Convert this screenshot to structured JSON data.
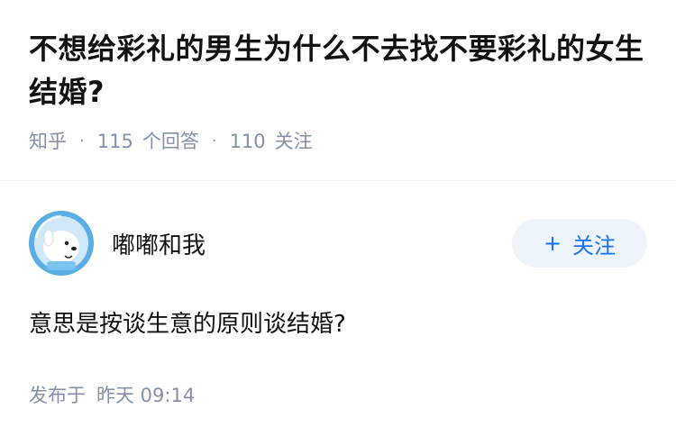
{
  "question": {
    "title": "不想给彩礼的男生为什么不去找不要彩礼的女生结婚?",
    "source": "知乎",
    "answer_count": "115",
    "answer_label": "个回答",
    "follower_count": "110",
    "follower_label": "关注"
  },
  "answer": {
    "author_name": "嘟嘟和我",
    "follow_label": "关注",
    "content": "意思是按谈生意的原则谈结婚?",
    "published_prefix": "发布于",
    "published_time": "昨天 09:14"
  },
  "colors": {
    "accent": "#1772f6",
    "meta_text": "#8590a6",
    "follow_bg": "#eef4fb"
  }
}
